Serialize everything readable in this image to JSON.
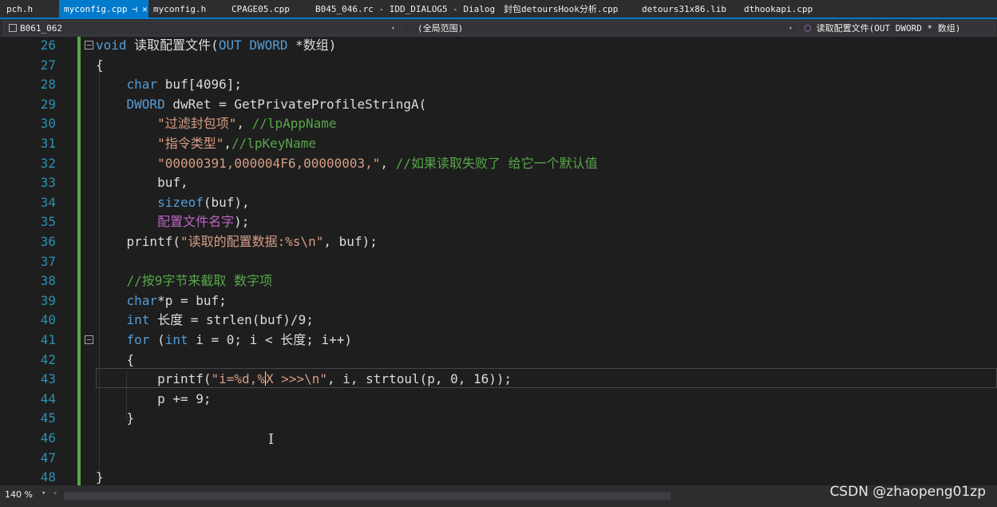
{
  "tabs": [
    {
      "label": "pch.h",
      "active": false
    },
    {
      "label": "myconfig.cpp",
      "active": true,
      "pin": "⊣",
      "close": "✕"
    },
    {
      "label": "myconfig.h",
      "active": false
    },
    {
      "label": "CPAGE05.cpp",
      "active": false
    },
    {
      "label": "B045_046.rc - IDD_DIALOG5 - Dialog",
      "active": false
    },
    {
      "label": "封包detoursHook分析.cpp",
      "active": false
    },
    {
      "label": "detours31x86.lib",
      "active": false
    },
    {
      "label": "dthookapi.cpp",
      "active": false
    }
  ],
  "nav": {
    "project": "B061_062",
    "scope": "(全局范围)",
    "function": "读取配置文件(OUT DWORD * 数组)"
  },
  "lines": [
    {
      "n": "26",
      "fold": "−",
      "tokens": [
        [
          "kw",
          "void"
        ],
        [
          "fn",
          " 读取配置文件("
        ],
        [
          "kw",
          "OUT"
        ],
        [
          "fn",
          " "
        ],
        [
          "kw",
          "DWORD"
        ],
        [
          "fn",
          " *数组)"
        ]
      ]
    },
    {
      "n": "27",
      "tokens": [
        [
          "fn",
          "{"
        ]
      ]
    },
    {
      "n": "28",
      "tokens": [
        [
          "fn",
          "    "
        ],
        [
          "kw",
          "char"
        ],
        [
          "fn",
          " buf[4096];"
        ]
      ]
    },
    {
      "n": "29",
      "tokens": [
        [
          "fn",
          "    "
        ],
        [
          "kw",
          "DWORD"
        ],
        [
          "fn",
          " dwRet = GetPrivateProfileStringA("
        ]
      ]
    },
    {
      "n": "30",
      "tokens": [
        [
          "fn",
          "        "
        ],
        [
          "str",
          "\"过滤封包项\""
        ],
        [
          "fn",
          ", "
        ],
        [
          "cm",
          "//lpAppName"
        ]
      ]
    },
    {
      "n": "31",
      "tokens": [
        [
          "fn",
          "        "
        ],
        [
          "str",
          "\"指令类型\""
        ],
        [
          "fn",
          ","
        ],
        [
          "cm",
          "//lpKeyName"
        ]
      ]
    },
    {
      "n": "32",
      "tokens": [
        [
          "fn",
          "        "
        ],
        [
          "str",
          "\"00000391,000004F6,00000003,\""
        ],
        [
          "fn",
          ", "
        ],
        [
          "cm",
          "//如果读取失败了 给它一个默认值"
        ]
      ]
    },
    {
      "n": "33",
      "tokens": [
        [
          "fn",
          "        buf,"
        ]
      ]
    },
    {
      "n": "34",
      "tokens": [
        [
          "fn",
          "        "
        ],
        [
          "kw",
          "sizeof"
        ],
        [
          "fn",
          "(buf),"
        ]
      ]
    },
    {
      "n": "35",
      "tokens": [
        [
          "fn",
          "        "
        ],
        [
          "mac",
          "配置文件名字"
        ],
        [
          "fn",
          ");"
        ]
      ]
    },
    {
      "n": "36",
      "tokens": [
        [
          "fn",
          "    printf("
        ],
        [
          "str",
          "\"读取的配置数据:%s\\n\""
        ],
        [
          "fn",
          ", buf);"
        ]
      ]
    },
    {
      "n": "37",
      "tokens": []
    },
    {
      "n": "38",
      "tokens": [
        [
          "fn",
          "    "
        ],
        [
          "cm",
          "//按9字节来截取 数字项"
        ]
      ]
    },
    {
      "n": "39",
      "tokens": [
        [
          "fn",
          "    "
        ],
        [
          "kw",
          "char"
        ],
        [
          "fn",
          "*p = buf;"
        ]
      ]
    },
    {
      "n": "40",
      "tokens": [
        [
          "fn",
          "    "
        ],
        [
          "kw",
          "int"
        ],
        [
          "fn",
          " 长度 = strlen(buf)/9;"
        ]
      ]
    },
    {
      "n": "41",
      "fold": "−",
      "tokens": [
        [
          "fn",
          "    "
        ],
        [
          "kw",
          "for"
        ],
        [
          "fn",
          " ("
        ],
        [
          "kw",
          "int"
        ],
        [
          "fn",
          " i = 0; i < 长度; i++)"
        ]
      ]
    },
    {
      "n": "42",
      "tokens": [
        [
          "fn",
          "    {"
        ]
      ]
    },
    {
      "n": "43",
      "caret": true,
      "tokens": [
        [
          "fn",
          "        printf("
        ],
        [
          "str",
          "\"i=%d,%"
        ],
        [
          "caret",
          ""
        ],
        [
          "str",
          "X >>>\\n\""
        ],
        [
          "fn",
          ", i, strtoul(p, 0, 16));"
        ]
      ]
    },
    {
      "n": "44",
      "tokens": [
        [
          "fn",
          "        p += 9;"
        ]
      ]
    },
    {
      "n": "45",
      "tokens": [
        [
          "fn",
          "    }"
        ]
      ]
    },
    {
      "n": "46",
      "tokens": []
    },
    {
      "n": "47",
      "tokens": []
    },
    {
      "n": "48",
      "tokens": [
        [
          "fn",
          "}"
        ]
      ]
    }
  ],
  "status": {
    "zoom": "140 %",
    "watermark": "CSDN @zhaopeng01zp"
  },
  "colors": {
    "keyword": "#569cd6",
    "string": "#d69d85",
    "comment": "#57a64a",
    "macro": "#bd63c5",
    "line_number": "#2b91af",
    "accent": "#007acc"
  }
}
